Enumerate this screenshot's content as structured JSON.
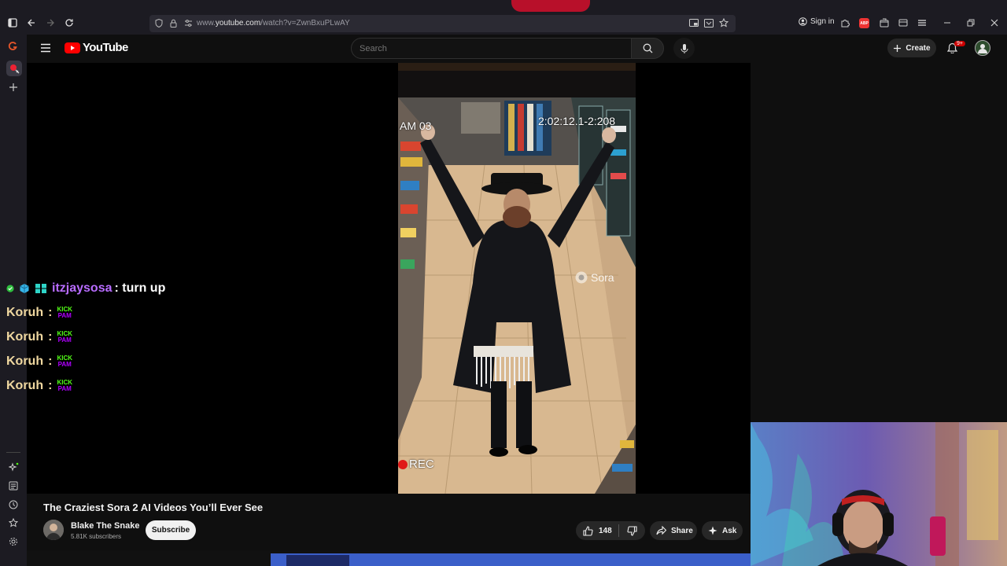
{
  "browser": {
    "url_prefix": "www.",
    "url_domain": "youtube.com",
    "url_rest": "/watch?v=ZwnBxuPLwAY",
    "sign_in": "Sign in",
    "adblock_badge": "ABP"
  },
  "youtube": {
    "logo_text": "YouTube",
    "search_placeholder": "Search",
    "create_label": "Create",
    "notification_count": "9+"
  },
  "video_overlay": {
    "cam_left": "AM 03",
    "cam_timestamp": "2:02:12.1-2:208",
    "watermark": "Sora",
    "rec_label": "REC"
  },
  "chat": {
    "first": {
      "user": "itzjaysosa",
      "message": ": turn up"
    },
    "repeats": [
      {
        "user": "Koruh",
        "sep": ":",
        "emote1": "KICK",
        "emote2": "PAM"
      },
      {
        "user": "Koruh",
        "sep": ":",
        "emote1": "KICK",
        "emote2": "PAM"
      },
      {
        "user": "Koruh",
        "sep": ":",
        "emote1": "KICK",
        "emote2": "PAM"
      },
      {
        "user": "Koruh",
        "sep": ":",
        "emote1": "KICK",
        "emote2": "PAM"
      }
    ]
  },
  "video_info": {
    "title": "The Craziest Sora 2 AI Videos You’ll Ever See",
    "channel": "Blake The Snake",
    "subscribers": "5.81K subscribers",
    "subscribe_label": "Subscribe",
    "likes": "148",
    "share_label": "Share",
    "ask_label": "Ask"
  },
  "colors": {
    "yt_red": "#ff0000",
    "chat_purple": "#b86cff",
    "chat_gold": "#f0d8a0"
  }
}
